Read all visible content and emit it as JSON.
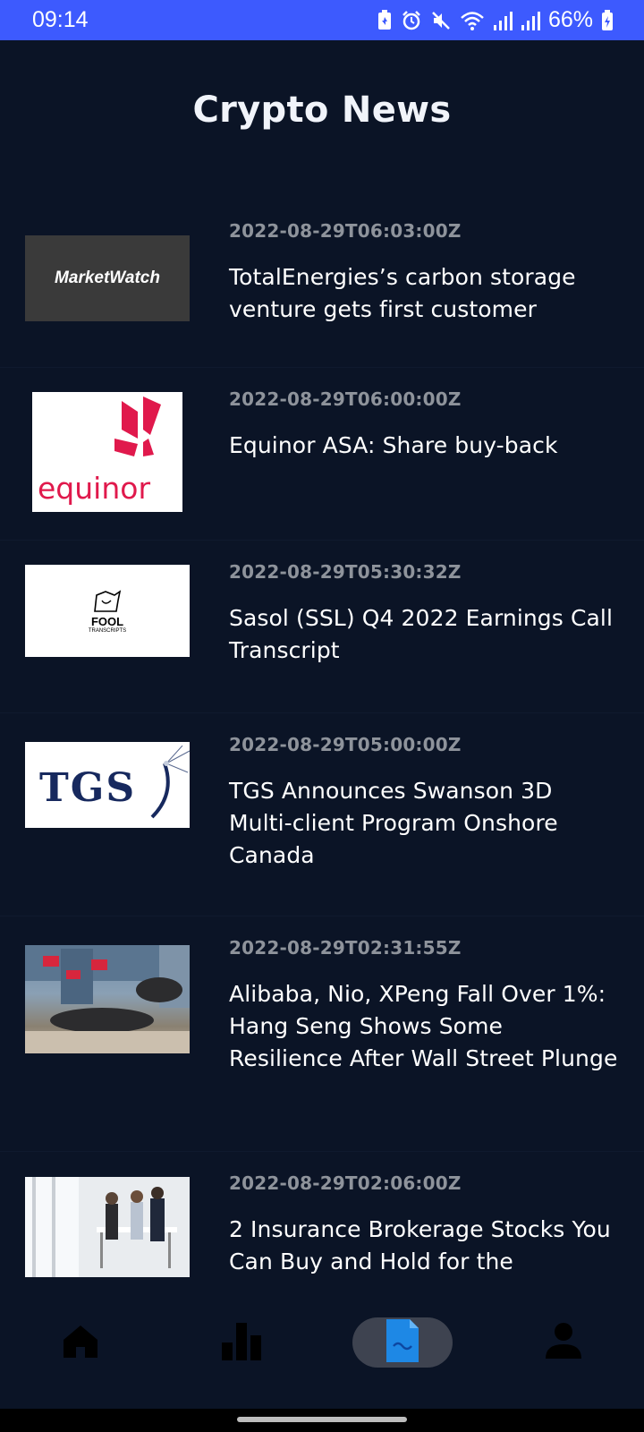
{
  "status_bar": {
    "time": "09:14",
    "battery": "66%",
    "icons": [
      "battery-saver-icon",
      "alarm-icon",
      "mute-icon",
      "wifi-icon",
      "signal-icon",
      "signal-icon",
      "battery-icon"
    ]
  },
  "header": {
    "title": "Crypto News"
  },
  "news": [
    {
      "date": "2022-08-29T06:03:00Z",
      "title": "TotalEnergies’s carbon storage venture gets first customer",
      "thumb_text": "MarketWatch"
    },
    {
      "date": "2022-08-29T06:00:00Z",
      "title": "Equinor ASA: Share buy-back",
      "thumb_text": "equinor"
    },
    {
      "date": "2022-08-29T05:30:32Z",
      "title": "Sasol (SSL) Q4 2022 Earnings Call Transcript",
      "thumb_text": "FOOL",
      "thumb_subtext": "TRANSCRIPTS"
    },
    {
      "date": "2022-08-29T05:00:00Z",
      "title": "TGS Announces Swanson 3D Multi-client Program Onshore Canada",
      "thumb_text": "TGS"
    },
    {
      "date": "2022-08-29T02:31:55Z",
      "title": "Alibaba, Nio, XPeng Fall Over 1%: Hang Seng Shows Some Resilience After Wall Street Plunge"
    },
    {
      "date": "2022-08-29T02:06:00Z",
      "title": "2 Insurance Brokerage Stocks You Can Buy and Hold for the"
    }
  ],
  "bottom_nav": {
    "items": [
      {
        "icon": "home-icon",
        "selected": false
      },
      {
        "icon": "bar-chart-icon",
        "selected": false
      },
      {
        "icon": "news-icon",
        "selected": true
      },
      {
        "icon": "profile-icon",
        "selected": false
      }
    ]
  },
  "colors": {
    "background": "#0b1426",
    "status_bar": "#3d5afe",
    "date_text": "#8e939b",
    "active_nav_icon": "#1e88e5",
    "nav_icon": "#000000",
    "nav_pill": "#3e4350"
  }
}
